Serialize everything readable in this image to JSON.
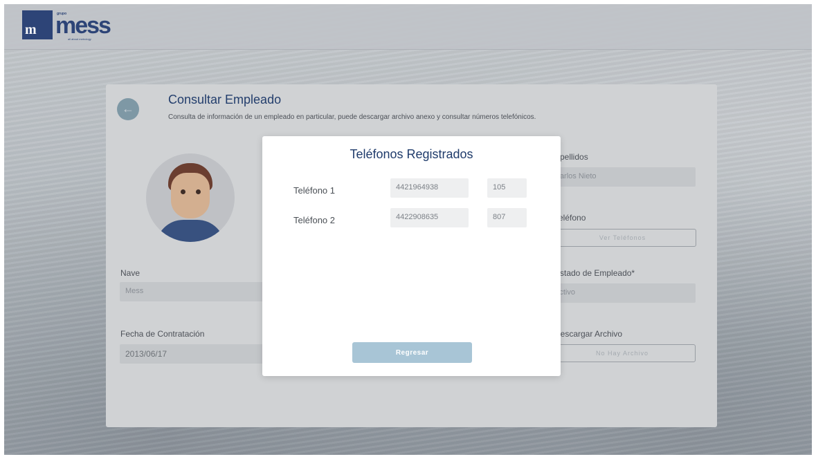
{
  "header": {
    "logo_grupo": "grupo",
    "logo_mark": "m",
    "logo_word": "mess",
    "logo_tagline": "all about metrology"
  },
  "page": {
    "title": "Consultar Empleado",
    "subtitle": "Consulta de información de un empleado en particular, puede descargar archivo anexo y consultar números telefónicos.",
    "back_icon": "arrow-left-icon"
  },
  "form": {
    "nave_label": "Nave",
    "nave_value": "Mess",
    "fecha_label": "Fecha de Contratación",
    "fecha_value": "2013/06/17",
    "apellidos_label": "Apellidos",
    "apellidos_value": "Carlos Nieto",
    "telefono_label": "Teléfono",
    "ver_telefonos_button": "Ver Teléfonos",
    "estado_label": "Estado de Empleado*",
    "estado_value": "Activo",
    "descargar_label": "Descargar Archivo",
    "no_archivo_button": "No Hay Archivo"
  },
  "modal": {
    "title": "Teléfonos Registrados",
    "phones": [
      {
        "label": "Teléfono 1",
        "number": "4421964938",
        "ext": "105"
      },
      {
        "label": "Teléfono 2",
        "number": "4422908635",
        "ext": "807"
      }
    ],
    "back_button": "Regresar"
  },
  "colors": {
    "brand": "#2a4276",
    "title": "#1f3b6b",
    "button": "#a8c5d6"
  }
}
